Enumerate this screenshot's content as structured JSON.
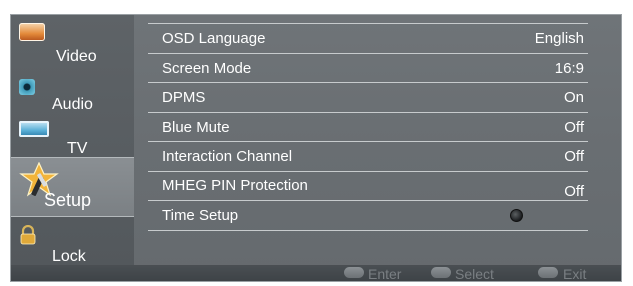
{
  "sidebar": {
    "items": [
      {
        "label": "Video",
        "icon": "video-icon",
        "active": false
      },
      {
        "label": "Audio",
        "icon": "audio-icon",
        "active": false
      },
      {
        "label": "TV",
        "icon": "tv-icon",
        "active": false
      },
      {
        "label": "Setup",
        "icon": "setup-icon",
        "active": true
      },
      {
        "label": "Lock",
        "icon": "lock-icon",
        "active": false
      }
    ]
  },
  "setup_menu": {
    "rows": [
      {
        "name": "OSD Language",
        "value": "English"
      },
      {
        "name": "Screen Mode",
        "value": "16:9"
      },
      {
        "name": "DPMS",
        "value": "On"
      },
      {
        "name": "Blue Mute",
        "value": "Off"
      },
      {
        "name": "Interaction Channel",
        "value": "Off"
      },
      {
        "name": "MHEG PIN Protection",
        "value": "Off"
      },
      {
        "name": "Time Setup",
        "value": ""
      }
    ]
  },
  "footer": {
    "enter_label": "Enter",
    "select_label": "Select",
    "exit_label": "Exit"
  },
  "colors": {
    "panel": "#6b7074",
    "sidebar": "#585d61",
    "text": "#ffffff",
    "hint": "#7a7f83"
  }
}
